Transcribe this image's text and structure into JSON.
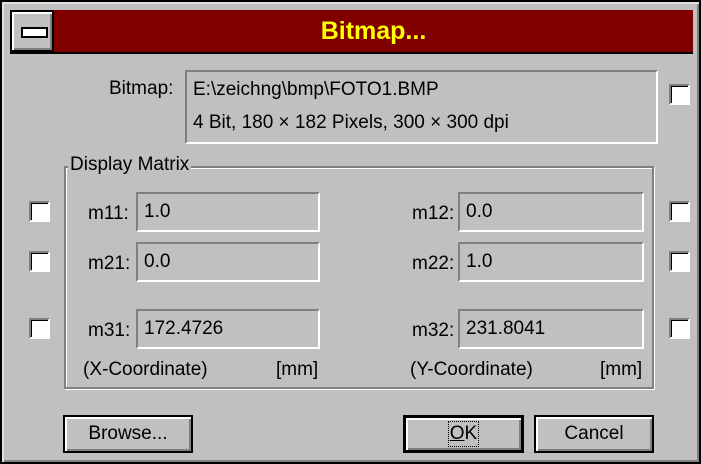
{
  "window": {
    "title": "Bitmap..."
  },
  "bitmap": {
    "label": "Bitmap:",
    "path": "E:\\zeichng\\bmp\\FOTO1.BMP",
    "info": "4 Bit, 180 × 182 Pixels, 300 × 300 dpi"
  },
  "matrix": {
    "title": "Display Matrix",
    "m11": {
      "label": "m11:",
      "value": "1.0"
    },
    "m12": {
      "label": "m12:",
      "value": "0.0"
    },
    "m21": {
      "label": "m21:",
      "value": "0.0"
    },
    "m22": {
      "label": "m22:",
      "value": "1.0"
    },
    "m31": {
      "label": "m31:",
      "value": "172.4726"
    },
    "m32": {
      "label": "m32:",
      "value": "231.8041"
    },
    "x_caption": "(X-Coordinate)",
    "y_caption": "(Y-Coordinate)",
    "unit": "[mm]"
  },
  "buttons": {
    "browse": "Browse...",
    "ok": "OK",
    "cancel": "Cancel"
  },
  "colors": {
    "titlebar": "#800000",
    "title_text": "#ffff00",
    "face": "#c0c0c0"
  }
}
